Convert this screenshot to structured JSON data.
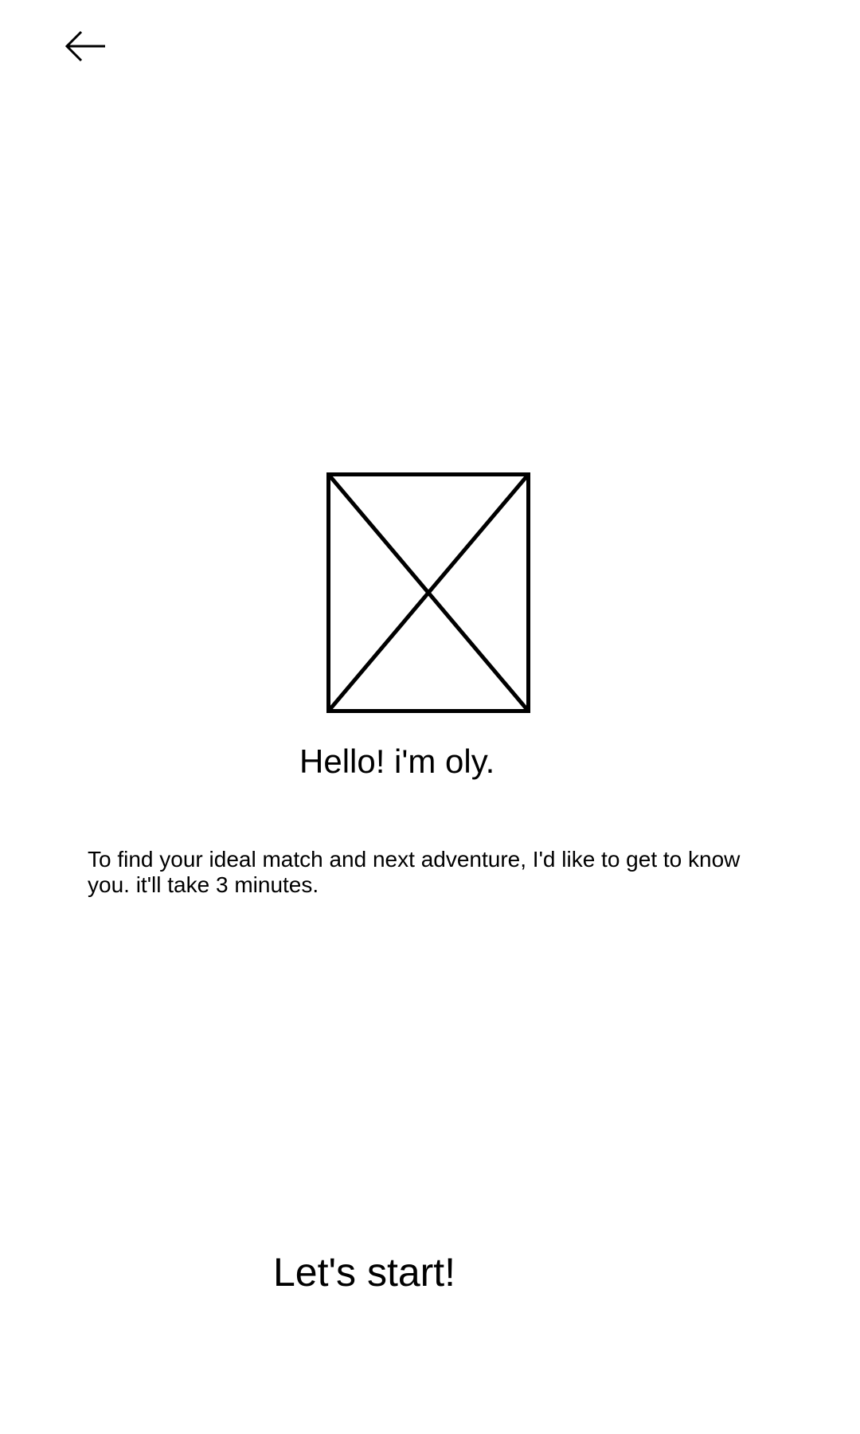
{
  "header": {
    "back_icon": "arrow-left-icon"
  },
  "mascot": {
    "icon": "image-placeholder-icon"
  },
  "greeting": "Hello! i'm oly.",
  "intro_text": "To find your ideal match and next adventure, I'd like to get to know you. it'll take 3 minutes.",
  "start_label": "Let's start!",
  "colors": {
    "background": "#ffffff",
    "text": "#000000"
  }
}
